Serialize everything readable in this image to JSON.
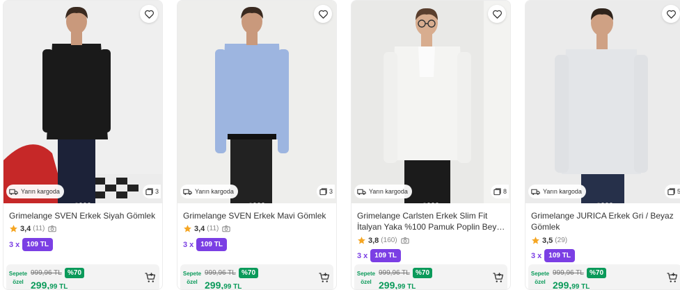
{
  "colors": {
    "accent_purple": "#7b3fe4",
    "discount_green": "#0b9a5a",
    "star_orange": "#f5a623"
  },
  "products": [
    {
      "title": "Grimelange SVEN Erkek Siyah Gömlek",
      "shipping": "Yarın kargoda",
      "photo_count": "3",
      "rating": "3,4",
      "review_count": "(11)",
      "has_camera_icon": true,
      "installment_prefix": "3 x",
      "installment_amount": "109 TL",
      "basket_label_1": "Sepete",
      "basket_label_2": "özel",
      "old_price": "999,96 TL",
      "discount": "%70",
      "new_price_int": "299,",
      "new_price_dec": "99 TL",
      "shirt_color": "#1a1a1a"
    },
    {
      "title": "Grimelange SVEN Erkek Mavi Gömlek",
      "shipping": "Yarın kargoda",
      "photo_count": "3",
      "rating": "3,4",
      "review_count": "(11)",
      "has_camera_icon": true,
      "installment_prefix": "3 x",
      "installment_amount": "109 TL",
      "basket_label_1": "Sepete",
      "basket_label_2": "özel",
      "old_price": "999,96 TL",
      "discount": "%70",
      "new_price_int": "299,",
      "new_price_dec": "99 TL",
      "shirt_color": "#9db5e0"
    },
    {
      "title": "Grimelange Carlsten Erkek Slim Fit İtalyan Yaka %100 Pamuk Poplin Beyaz Gömlek",
      "shipping": "Yarın kargoda",
      "photo_count": "8",
      "rating": "3,8",
      "review_count": "(160)",
      "has_camera_icon": true,
      "installment_prefix": "3 x",
      "installment_amount": "109 TL",
      "basket_label_1": "Sepete",
      "basket_label_2": "özel",
      "old_price": "999,96 TL",
      "discount": "%70",
      "new_price_int": "299,",
      "new_price_dec": "99 TL",
      "shirt_color": "#f4f4f2"
    },
    {
      "title": "Grimelange JURICA Erkek Gri / Beyaz Gömlek",
      "shipping": "Yarın kargoda",
      "photo_count": "5",
      "rating": "3,5",
      "review_count": "(29)",
      "has_camera_icon": false,
      "installment_prefix": "3 x",
      "installment_amount": "109 TL",
      "basket_label_1": "Sepete",
      "basket_label_2": "özel",
      "old_price": "999,96 TL",
      "discount": "%70",
      "new_price_int": "299,",
      "new_price_dec": "99 TL",
      "shirt_color": "#e3e5e8"
    }
  ]
}
